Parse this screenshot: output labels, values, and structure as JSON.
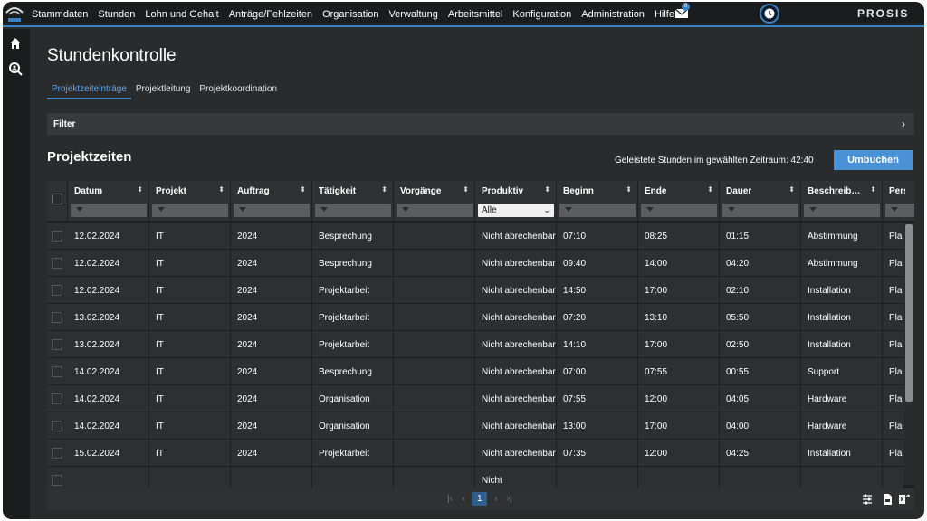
{
  "menu": [
    "Stammdaten",
    "Stunden",
    "Lohn und Gehalt",
    "Anträge/Fehlzeiten",
    "Organisation",
    "Verwaltung",
    "Arbeitsmittel",
    "Konfiguration",
    "Administration",
    "Hilfe"
  ],
  "mail_badge": "0",
  "brand": "PROSIS",
  "page_title": "Stundenkontrolle",
  "tabs": [
    "Projektzeiteinträge",
    "Projektleitung",
    "Projektkoordination"
  ],
  "filter_label": "Filter",
  "section_title": "Projektzeiten",
  "hours_text": "Geleistete Stunden im gewählten Zeitraum: 42:40",
  "umbuchen_label": "Umbuchen",
  "columns": [
    "Datum",
    "Projekt",
    "Auftrag",
    "Tätigkeit",
    "Vorgänge",
    "Produktiv",
    "Beginn",
    "Ende",
    "Dauer",
    "Beschreib…",
    "Perso"
  ],
  "produktiv_filter_value": "Alle",
  "rows": [
    [
      "12.02.2024",
      "IT",
      "2024",
      "Besprechung",
      "",
      "Nicht abrechenbar",
      "07:10",
      "08:25",
      "01:15",
      "Abstimmung",
      "Pla"
    ],
    [
      "12.02.2024",
      "IT",
      "2024",
      "Besprechung",
      "",
      "Nicht abrechenbar",
      "09:40",
      "14:00",
      "04:20",
      "Abstimmung",
      "Pla"
    ],
    [
      "12.02.2024",
      "IT",
      "2024",
      "Projektarbeit",
      "",
      "Nicht abrechenbar",
      "14:50",
      "17:00",
      "02:10",
      "Installation",
      "Pla"
    ],
    [
      "13.02.2024",
      "IT",
      "2024",
      "Projektarbeit",
      "",
      "Nicht abrechenbar",
      "07:20",
      "13:10",
      "05:50",
      "Installation",
      "Pla"
    ],
    [
      "13.02.2024",
      "IT",
      "2024",
      "Projektarbeit",
      "",
      "Nicht abrechenbar",
      "14:10",
      "17:00",
      "02:50",
      "Installation",
      "Pla"
    ],
    [
      "14.02.2024",
      "IT",
      "2024",
      "Besprechung",
      "",
      "Nicht abrechenbar",
      "07:00",
      "07:55",
      "00:55",
      "Support",
      "Pla"
    ],
    [
      "14.02.2024",
      "IT",
      "2024",
      "Organisation",
      "",
      "Nicht abrechenbar",
      "07:55",
      "12:00",
      "04:05",
      "Hardware",
      "Pla"
    ],
    [
      "14.02.2024",
      "IT",
      "2024",
      "Organisation",
      "",
      "Nicht abrechenbar",
      "13:00",
      "17:00",
      "04:00",
      "Hardware",
      "Pla"
    ],
    [
      "15.02.2024",
      "IT",
      "2024",
      "Projektarbeit",
      "",
      "Nicht abrechenbar",
      "07:35",
      "12:00",
      "04:25",
      "Installation",
      "Pla"
    ],
    [
      "",
      "",
      "",
      "",
      "",
      "Nicht",
      "",
      "",
      "",
      "",
      ""
    ]
  ],
  "pager": {
    "first": "|‹",
    "prev": "‹",
    "page": "1",
    "next": "›",
    "last": "›|"
  },
  "icons": {
    "home": "home-icon",
    "search": "search-user-icon",
    "mail": "mail-icon",
    "clock": "clock-icon",
    "settings": "column-settings-icon",
    "export_pdf": "pdf-export-icon",
    "export_xls": "excel-export-icon"
  }
}
